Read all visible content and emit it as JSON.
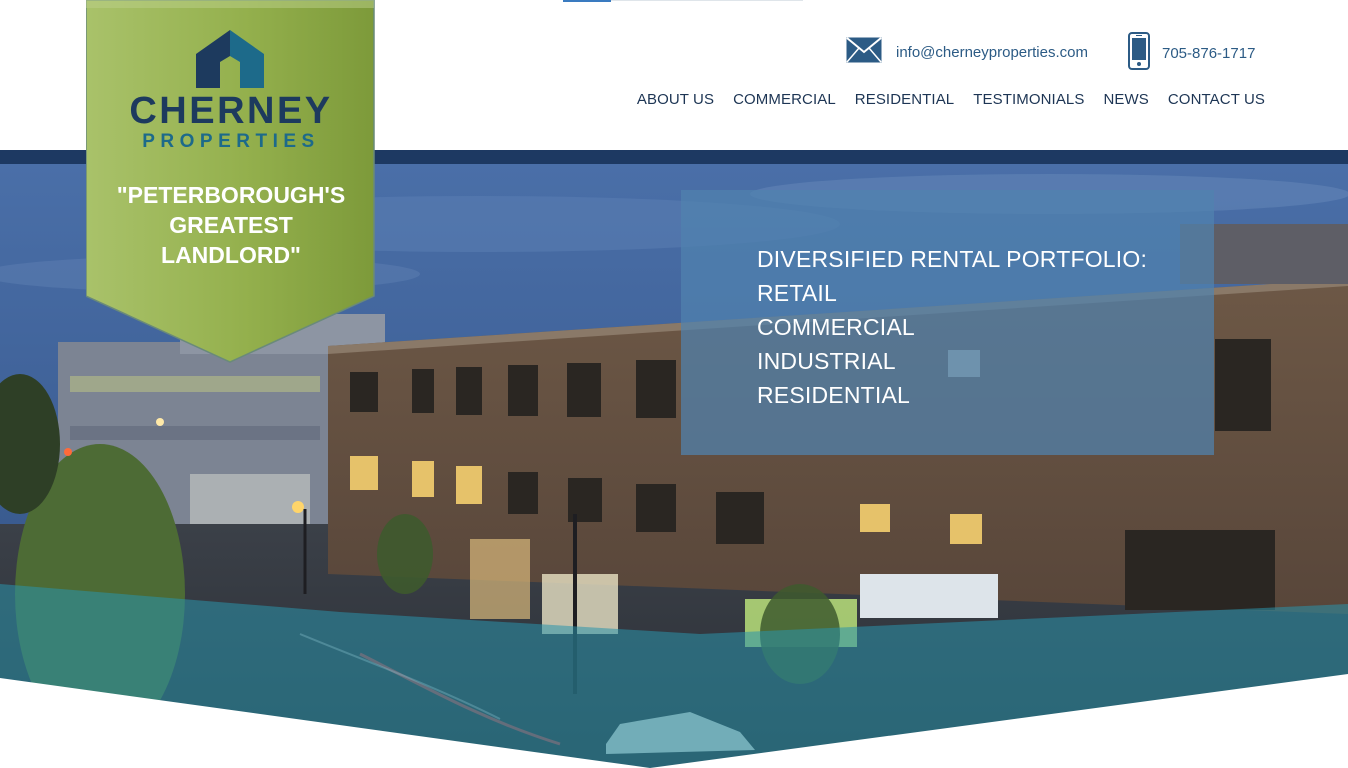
{
  "header": {
    "email": "info@cherneyproperties.com",
    "phone": "705-876-1717",
    "email_icon": "envelope-icon",
    "phone_icon": "mobile-phone-icon"
  },
  "nav": {
    "items": [
      {
        "label": "ABOUT US"
      },
      {
        "label": "COMMERCIAL"
      },
      {
        "label": "RESIDENTIAL"
      },
      {
        "label": "TESTIMONIALS"
      },
      {
        "label": "NEWS"
      },
      {
        "label": "CONTACT US"
      }
    ]
  },
  "brand": {
    "name": "CHERNEY",
    "sub": "PROPERTIES",
    "tagline": [
      "\"PETERBOROUGH'S",
      "GREATEST",
      "LANDLORD\""
    ]
  },
  "hero": {
    "lines": [
      "DIVERSIFIED RENTAL PORTFOLIO:",
      "RETAIL",
      "COMMERCIAL",
      "INDUSTRIAL",
      "RESIDENTIAL"
    ]
  },
  "colors": {
    "navy": "#1d3962",
    "brand_green": "#9ab550",
    "teal": "#1d6a8a",
    "link_blue": "#2c5b85"
  }
}
